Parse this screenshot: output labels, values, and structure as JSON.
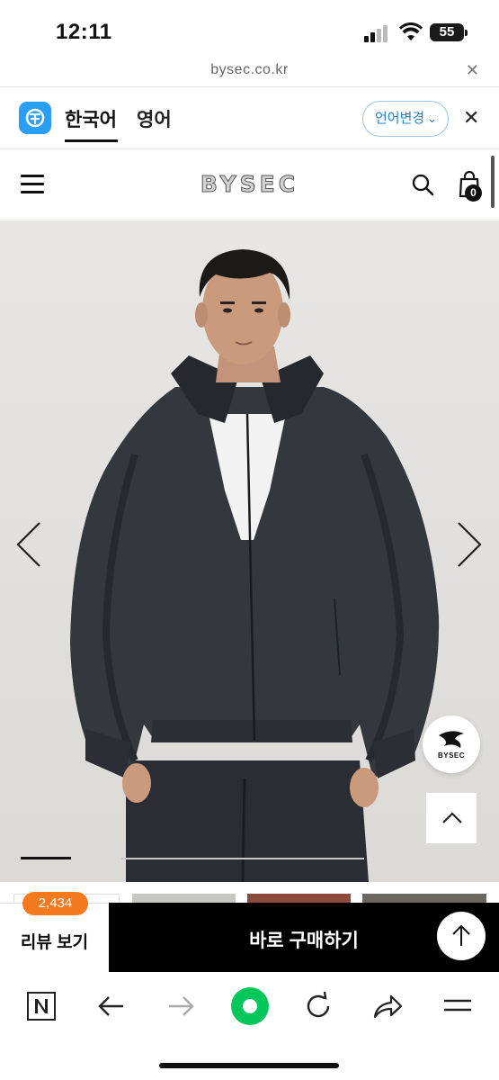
{
  "status_bar": {
    "time": "12:11",
    "battery": "55"
  },
  "browser": {
    "url": "bysec.co.kr"
  },
  "translate_bar": {
    "tabs": [
      "한국어",
      "영어"
    ],
    "active_tab": "한국어",
    "change_language": "언어변경"
  },
  "site_header": {
    "brand": "BYSEC",
    "cart_count": "0"
  },
  "product": {
    "float_badge": "BYSEC"
  },
  "buy_bar": {
    "review_label": "리뷰 보기",
    "review_count": "2,434",
    "buy_label": "바로 구매하기"
  },
  "colors": {
    "accent_orange": "#f47a20",
    "link_blue": "#2680c2",
    "buy_black": "#000000",
    "naver_green": "#03c75a"
  },
  "toolbar": {
    "icons": [
      "naver-icon",
      "back-icon",
      "forward-icon",
      "green-home-icon",
      "refresh-icon",
      "share-icon",
      "menu-icon"
    ]
  }
}
